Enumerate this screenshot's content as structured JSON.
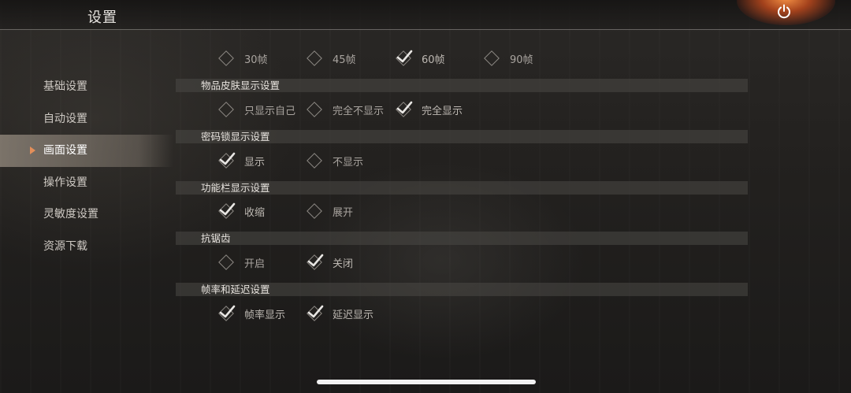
{
  "header": {
    "title": "设置",
    "power_icon": "power-icon"
  },
  "sidebar": {
    "items": [
      {
        "label": "基础设置",
        "active": false
      },
      {
        "label": "自动设置",
        "active": false
      },
      {
        "label": "画面设置",
        "active": true
      },
      {
        "label": "操作设置",
        "active": false
      },
      {
        "label": "灵敏度设置",
        "active": false
      },
      {
        "label": "资源下载",
        "active": false
      }
    ]
  },
  "framerate": {
    "options": [
      {
        "label": "30帧",
        "checked": false
      },
      {
        "label": "45帧",
        "checked": false
      },
      {
        "label": "60帧",
        "checked": true
      },
      {
        "label": "90帧",
        "checked": false
      }
    ]
  },
  "sections": [
    {
      "title": "物品皮肤显示设置",
      "options": [
        {
          "label": "只显示自己",
          "checked": false
        },
        {
          "label": "完全不显示",
          "checked": false
        },
        {
          "label": "完全显示",
          "checked": true
        }
      ]
    },
    {
      "title": "密码锁显示设置",
      "options": [
        {
          "label": "显示",
          "checked": true
        },
        {
          "label": "不显示",
          "checked": false
        }
      ]
    },
    {
      "title": "功能栏显示设置",
      "options": [
        {
          "label": "收缩",
          "checked": true
        },
        {
          "label": "展开",
          "checked": false
        }
      ]
    },
    {
      "title": "抗锯齿",
      "options": [
        {
          "label": "开启",
          "checked": false
        },
        {
          "label": "关闭",
          "checked": true
        }
      ]
    },
    {
      "title": "帧率和延迟设置",
      "options": [
        {
          "label": "帧率显示",
          "checked": true
        },
        {
          "label": "延迟显示",
          "checked": true
        }
      ]
    }
  ],
  "colors": {
    "accent": "#e38f5a",
    "check": "#e8e6e3",
    "text": "#a9a49f"
  }
}
